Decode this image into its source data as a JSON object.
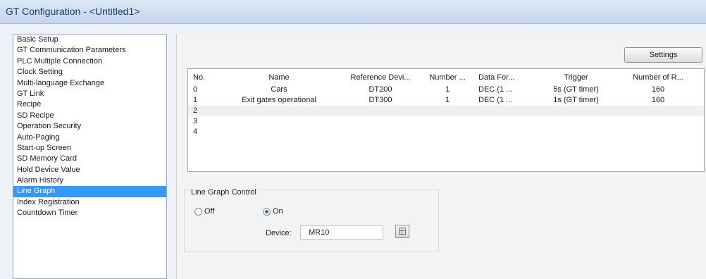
{
  "window": {
    "title": "GT Configuration - <Untitled1>"
  },
  "sidebar": {
    "items": [
      {
        "label": "Basic Setup"
      },
      {
        "label": "GT Communication Parameters"
      },
      {
        "label": "PLC Multiple Connection"
      },
      {
        "label": "Clock Setting"
      },
      {
        "label": "Multi-language Exchange"
      },
      {
        "label": "GT Link"
      },
      {
        "label": "Recipe"
      },
      {
        "label": "SD Recipe"
      },
      {
        "label": "Operation Security"
      },
      {
        "label": "Auto-Paging"
      },
      {
        "label": "Start-up Screen"
      },
      {
        "label": "SD Memory Card"
      },
      {
        "label": "Hold Device Value"
      },
      {
        "label": "Alarm History"
      },
      {
        "label": "Line Graph",
        "selected": true
      },
      {
        "label": "Index Registration"
      },
      {
        "label": "Countdown Timer"
      }
    ]
  },
  "toolbar": {
    "settings_label": "Settings"
  },
  "table": {
    "columns": [
      "No.",
      "Name",
      "Reference Devi...",
      "Number ...",
      "Data For...",
      "Trigger",
      "Number of R..."
    ],
    "rows": [
      [
        "0",
        "Cars",
        "DT200",
        "1",
        "DEC (1 ...",
        "5s (GT timer)",
        "160"
      ],
      [
        "1",
        "Exit gates operational",
        "DT300",
        "1",
        "DEC (1 ...",
        "1s (GT timer)",
        "160"
      ],
      [
        "2",
        "",
        "",
        "",
        "",
        "",
        ""
      ],
      [
        "3",
        "",
        "",
        "",
        "",
        "",
        ""
      ],
      [
        "4",
        "",
        "",
        "",
        "",
        "",
        ""
      ]
    ]
  },
  "line_graph_control": {
    "title": "Line Graph Control",
    "off_label": "Off",
    "on_label": "On",
    "selected": "On",
    "device_label": "Device:",
    "device_value": "MR10"
  }
}
